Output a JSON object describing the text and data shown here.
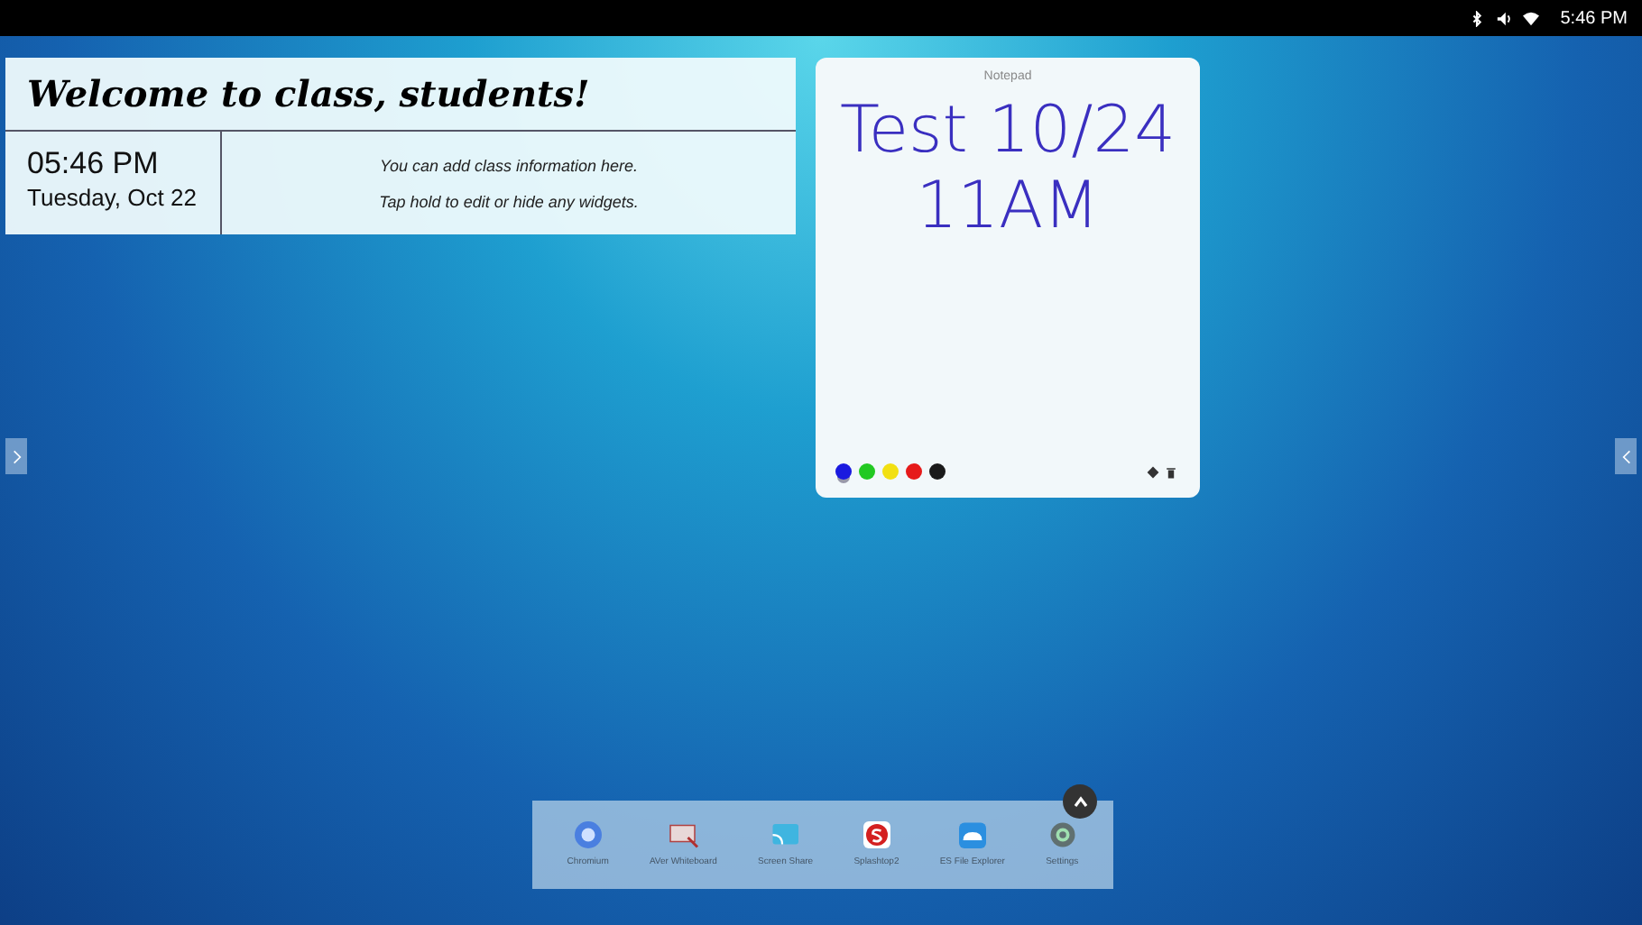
{
  "status_bar": {
    "time": "5:46 PM"
  },
  "welcome_widget": {
    "title": "Welcome to class, students!",
    "time": "05:46 PM",
    "date": "Tuesday, Oct 22",
    "info_lines": [
      "You can add class information here.",
      "Tap hold to edit or hide any widgets."
    ]
  },
  "notepad": {
    "title": "Notepad",
    "note_lines": [
      "Test 10/24",
      "11AM"
    ],
    "pen_colors": [
      {
        "color": "#1a1adf",
        "selected": true
      },
      {
        "color": "#22c922",
        "selected": false
      },
      {
        "color": "#f2e012",
        "selected": false
      },
      {
        "color": "#e61a1a",
        "selected": false
      },
      {
        "color": "#1a1a1a",
        "selected": false
      }
    ]
  },
  "dock": {
    "apps": [
      {
        "label": "Chromium",
        "kind": "browser"
      },
      {
        "label": "AVer Whiteboard",
        "kind": "whiteboard"
      },
      {
        "label": "Screen Share",
        "kind": "cast"
      },
      {
        "label": "Splashtop2",
        "kind": "remote"
      },
      {
        "label": "ES File Explorer",
        "kind": "files"
      },
      {
        "label": "Settings",
        "kind": "settings"
      }
    ]
  }
}
